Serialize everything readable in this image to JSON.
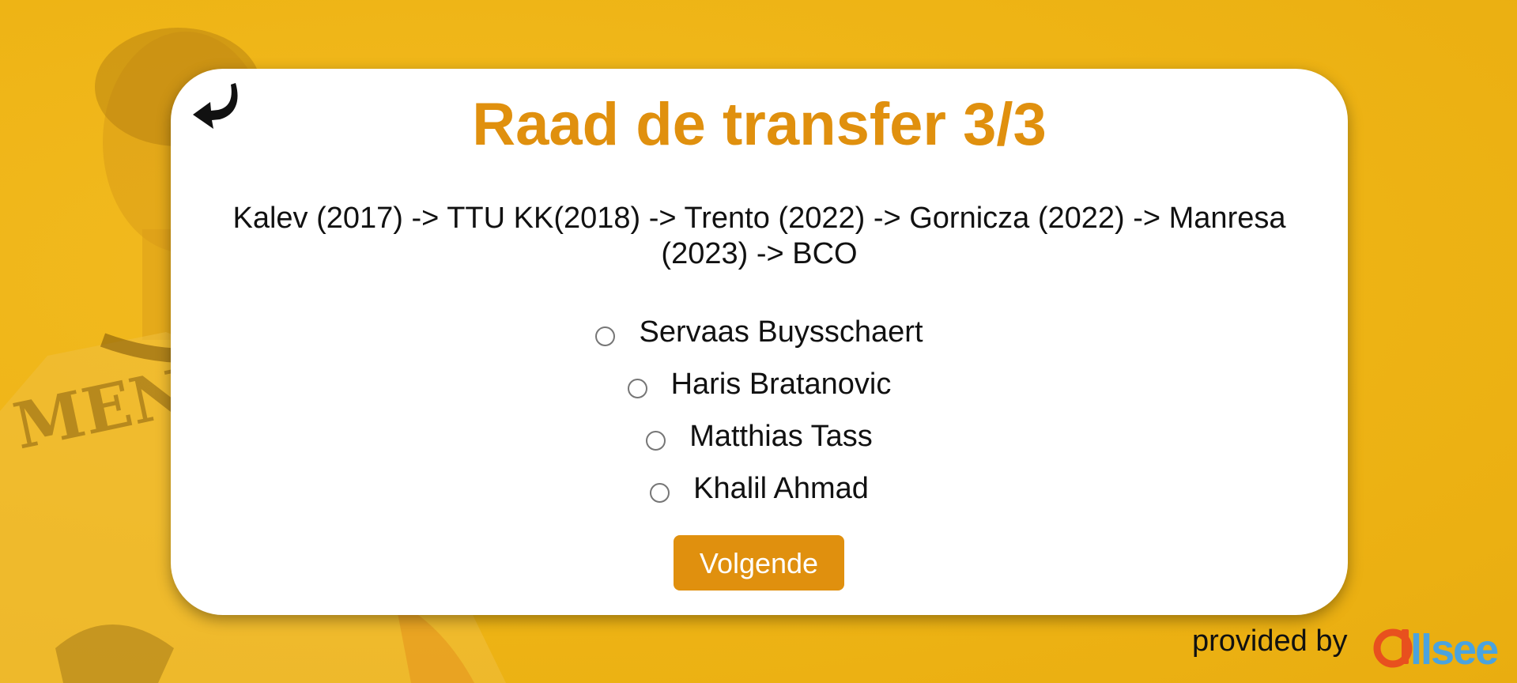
{
  "quiz": {
    "title": "Raad de transfer 3/3",
    "history": "Kalev (2017) -> TTU KK(2018) -> Trento (2022) -> Gornicza (2022) -> Manresa (2023) -> BCO",
    "options": [
      {
        "label": "Servaas Buysschaert"
      },
      {
        "label": "Haris Bratanovic"
      },
      {
        "label": "Matthias Tass"
      },
      {
        "label": "Khalil Ahmad"
      }
    ],
    "next_label": "Volgende"
  },
  "footer": {
    "provided_by": "provided by",
    "logo_text": "allsee"
  },
  "colors": {
    "accent": "#e0900e",
    "background": "#eeb415",
    "logo_orange": "#e8501e",
    "logo_blue": "#4aa3df"
  },
  "icons": {
    "back": "back-arrow-icon"
  }
}
